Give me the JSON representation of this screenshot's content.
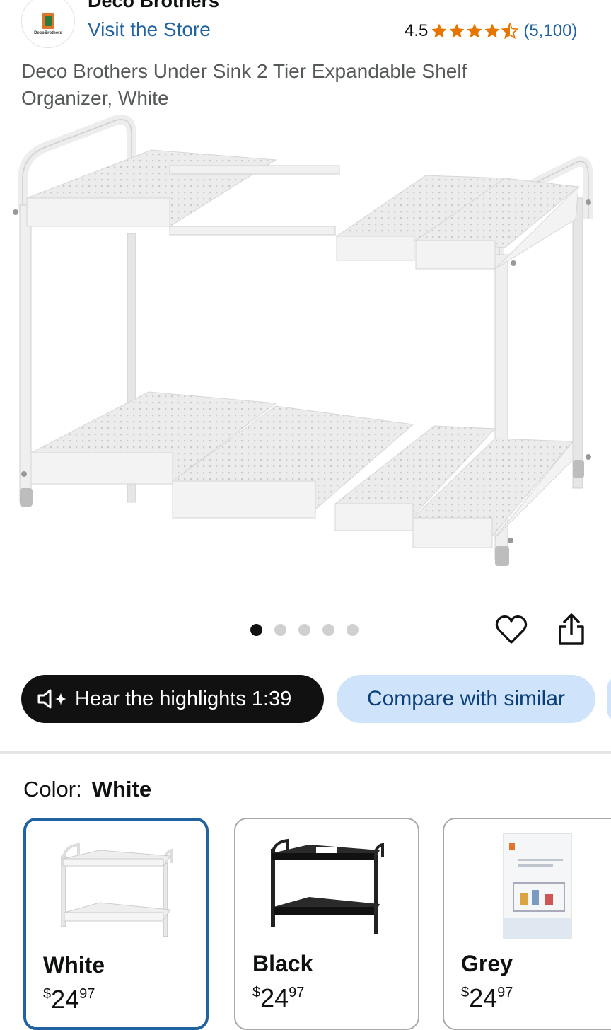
{
  "brand": {
    "name": "Deco Brothers",
    "logo_text": "DecoBrothers",
    "store_link": "Visit the Store"
  },
  "rating": {
    "value": "4.5",
    "stars": 4.5,
    "count": "(5,100)"
  },
  "product": {
    "title": "Deco Brothers Under Sink 2 Tier Expandable Shelf Organizer, White"
  },
  "gallery": {
    "image_count": 5,
    "active_index": 0
  },
  "actions": {
    "wishlist_icon": "heart-icon",
    "share_icon": "share-icon"
  },
  "chips": {
    "hear_label": "Hear the highlights 1:39",
    "compare_label": "Compare with similar"
  },
  "color": {
    "label": "Color:",
    "selected": "White",
    "options": [
      {
        "name": "White",
        "currency": "$",
        "whole": "24",
        "cents": "97"
      },
      {
        "name": "Black",
        "currency": "$",
        "whole": "24",
        "cents": "97"
      },
      {
        "name": "Grey",
        "currency": "$",
        "whole": "24",
        "cents": "97"
      }
    ]
  },
  "colors": {
    "link": "#2162a1",
    "star": "#e77600",
    "chip_dark": "#111111",
    "chip_light": "#cfe3fb",
    "selected_border": "#2162a1"
  }
}
